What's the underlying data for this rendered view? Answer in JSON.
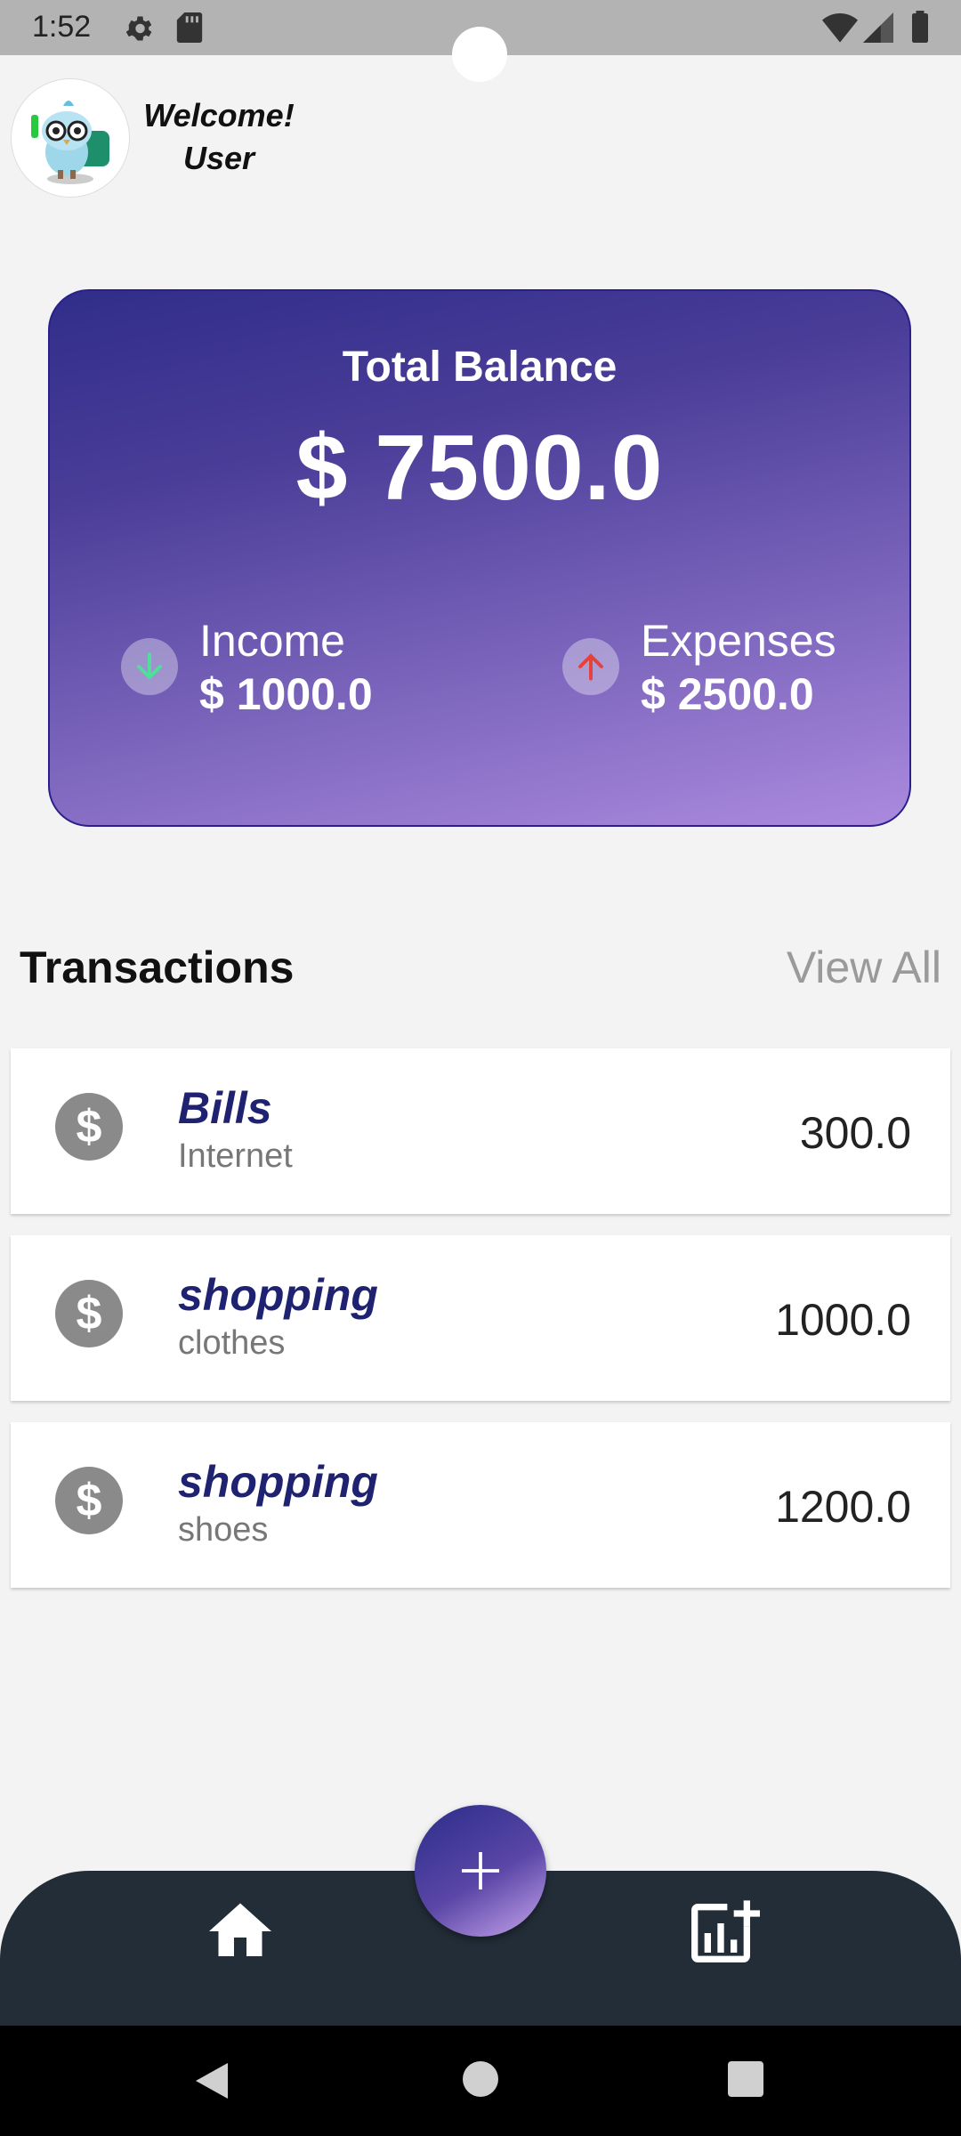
{
  "status_bar": {
    "time": "1:52",
    "icons": [
      "gear-icon",
      "sd-card-icon",
      "wifi-icon",
      "signal-icon",
      "battery-icon"
    ]
  },
  "header": {
    "welcome": "Welcome!",
    "user": "User",
    "avatar": "mascot-avatar"
  },
  "balance": {
    "title": "Total Balance",
    "amount": "$ 7500.0",
    "income_label": "Income",
    "income_value": "$ 1000.0",
    "expenses_label": "Expenses",
    "expenses_value": "$ 2500.0",
    "colors": {
      "gradient_start": "#302e8a",
      "gradient_end": "#ab8ade",
      "income_arrow": "#4ee09a",
      "expense_arrow": "#e5423a"
    }
  },
  "transactions": {
    "title": "Transactions",
    "view_all": "View All",
    "items": [
      {
        "category": "Bills",
        "note": "Internet",
        "amount": "300.0"
      },
      {
        "category": "shopping",
        "note": "clothes",
        "amount": "1000.0"
      },
      {
        "category": "shopping",
        "note": "shoes",
        "amount": "1200.0"
      }
    ]
  },
  "bottom_nav": {
    "items": [
      "home-icon",
      "add-chart-icon"
    ],
    "fab": "plus-icon",
    "background": "#222d38"
  },
  "system_nav": [
    "back-icon",
    "home-circle-icon",
    "recents-icon"
  ]
}
